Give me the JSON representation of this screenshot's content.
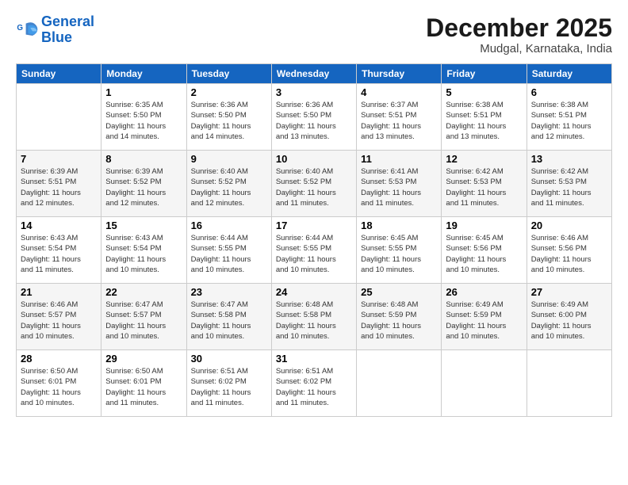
{
  "logo": {
    "line1": "General",
    "line2": "Blue"
  },
  "title": "December 2025",
  "location": "Mudgal, Karnataka, India",
  "days_of_week": [
    "Sunday",
    "Monday",
    "Tuesday",
    "Wednesday",
    "Thursday",
    "Friday",
    "Saturday"
  ],
  "weeks": [
    [
      {
        "day": "",
        "info": ""
      },
      {
        "day": "1",
        "info": "Sunrise: 6:35 AM\nSunset: 5:50 PM\nDaylight: 11 hours\nand 14 minutes."
      },
      {
        "day": "2",
        "info": "Sunrise: 6:36 AM\nSunset: 5:50 PM\nDaylight: 11 hours\nand 14 minutes."
      },
      {
        "day": "3",
        "info": "Sunrise: 6:36 AM\nSunset: 5:50 PM\nDaylight: 11 hours\nand 13 minutes."
      },
      {
        "day": "4",
        "info": "Sunrise: 6:37 AM\nSunset: 5:51 PM\nDaylight: 11 hours\nand 13 minutes."
      },
      {
        "day": "5",
        "info": "Sunrise: 6:38 AM\nSunset: 5:51 PM\nDaylight: 11 hours\nand 13 minutes."
      },
      {
        "day": "6",
        "info": "Sunrise: 6:38 AM\nSunset: 5:51 PM\nDaylight: 11 hours\nand 12 minutes."
      }
    ],
    [
      {
        "day": "7",
        "info": "Sunrise: 6:39 AM\nSunset: 5:51 PM\nDaylight: 11 hours\nand 12 minutes."
      },
      {
        "day": "8",
        "info": "Sunrise: 6:39 AM\nSunset: 5:52 PM\nDaylight: 11 hours\nand 12 minutes."
      },
      {
        "day": "9",
        "info": "Sunrise: 6:40 AM\nSunset: 5:52 PM\nDaylight: 11 hours\nand 12 minutes."
      },
      {
        "day": "10",
        "info": "Sunrise: 6:40 AM\nSunset: 5:52 PM\nDaylight: 11 hours\nand 11 minutes."
      },
      {
        "day": "11",
        "info": "Sunrise: 6:41 AM\nSunset: 5:53 PM\nDaylight: 11 hours\nand 11 minutes."
      },
      {
        "day": "12",
        "info": "Sunrise: 6:42 AM\nSunset: 5:53 PM\nDaylight: 11 hours\nand 11 minutes."
      },
      {
        "day": "13",
        "info": "Sunrise: 6:42 AM\nSunset: 5:53 PM\nDaylight: 11 hours\nand 11 minutes."
      }
    ],
    [
      {
        "day": "14",
        "info": "Sunrise: 6:43 AM\nSunset: 5:54 PM\nDaylight: 11 hours\nand 11 minutes."
      },
      {
        "day": "15",
        "info": "Sunrise: 6:43 AM\nSunset: 5:54 PM\nDaylight: 11 hours\nand 10 minutes."
      },
      {
        "day": "16",
        "info": "Sunrise: 6:44 AM\nSunset: 5:55 PM\nDaylight: 11 hours\nand 10 minutes."
      },
      {
        "day": "17",
        "info": "Sunrise: 6:44 AM\nSunset: 5:55 PM\nDaylight: 11 hours\nand 10 minutes."
      },
      {
        "day": "18",
        "info": "Sunrise: 6:45 AM\nSunset: 5:55 PM\nDaylight: 11 hours\nand 10 minutes."
      },
      {
        "day": "19",
        "info": "Sunrise: 6:45 AM\nSunset: 5:56 PM\nDaylight: 11 hours\nand 10 minutes."
      },
      {
        "day": "20",
        "info": "Sunrise: 6:46 AM\nSunset: 5:56 PM\nDaylight: 11 hours\nand 10 minutes."
      }
    ],
    [
      {
        "day": "21",
        "info": "Sunrise: 6:46 AM\nSunset: 5:57 PM\nDaylight: 11 hours\nand 10 minutes."
      },
      {
        "day": "22",
        "info": "Sunrise: 6:47 AM\nSunset: 5:57 PM\nDaylight: 11 hours\nand 10 minutes."
      },
      {
        "day": "23",
        "info": "Sunrise: 6:47 AM\nSunset: 5:58 PM\nDaylight: 11 hours\nand 10 minutes."
      },
      {
        "day": "24",
        "info": "Sunrise: 6:48 AM\nSunset: 5:58 PM\nDaylight: 11 hours\nand 10 minutes."
      },
      {
        "day": "25",
        "info": "Sunrise: 6:48 AM\nSunset: 5:59 PM\nDaylight: 11 hours\nand 10 minutes."
      },
      {
        "day": "26",
        "info": "Sunrise: 6:49 AM\nSunset: 5:59 PM\nDaylight: 11 hours\nand 10 minutes."
      },
      {
        "day": "27",
        "info": "Sunrise: 6:49 AM\nSunset: 6:00 PM\nDaylight: 11 hours\nand 10 minutes."
      }
    ],
    [
      {
        "day": "28",
        "info": "Sunrise: 6:50 AM\nSunset: 6:01 PM\nDaylight: 11 hours\nand 10 minutes."
      },
      {
        "day": "29",
        "info": "Sunrise: 6:50 AM\nSunset: 6:01 PM\nDaylight: 11 hours\nand 11 minutes."
      },
      {
        "day": "30",
        "info": "Sunrise: 6:51 AM\nSunset: 6:02 PM\nDaylight: 11 hours\nand 11 minutes."
      },
      {
        "day": "31",
        "info": "Sunrise: 6:51 AM\nSunset: 6:02 PM\nDaylight: 11 hours\nand 11 minutes."
      },
      {
        "day": "",
        "info": ""
      },
      {
        "day": "",
        "info": ""
      },
      {
        "day": "",
        "info": ""
      }
    ]
  ]
}
